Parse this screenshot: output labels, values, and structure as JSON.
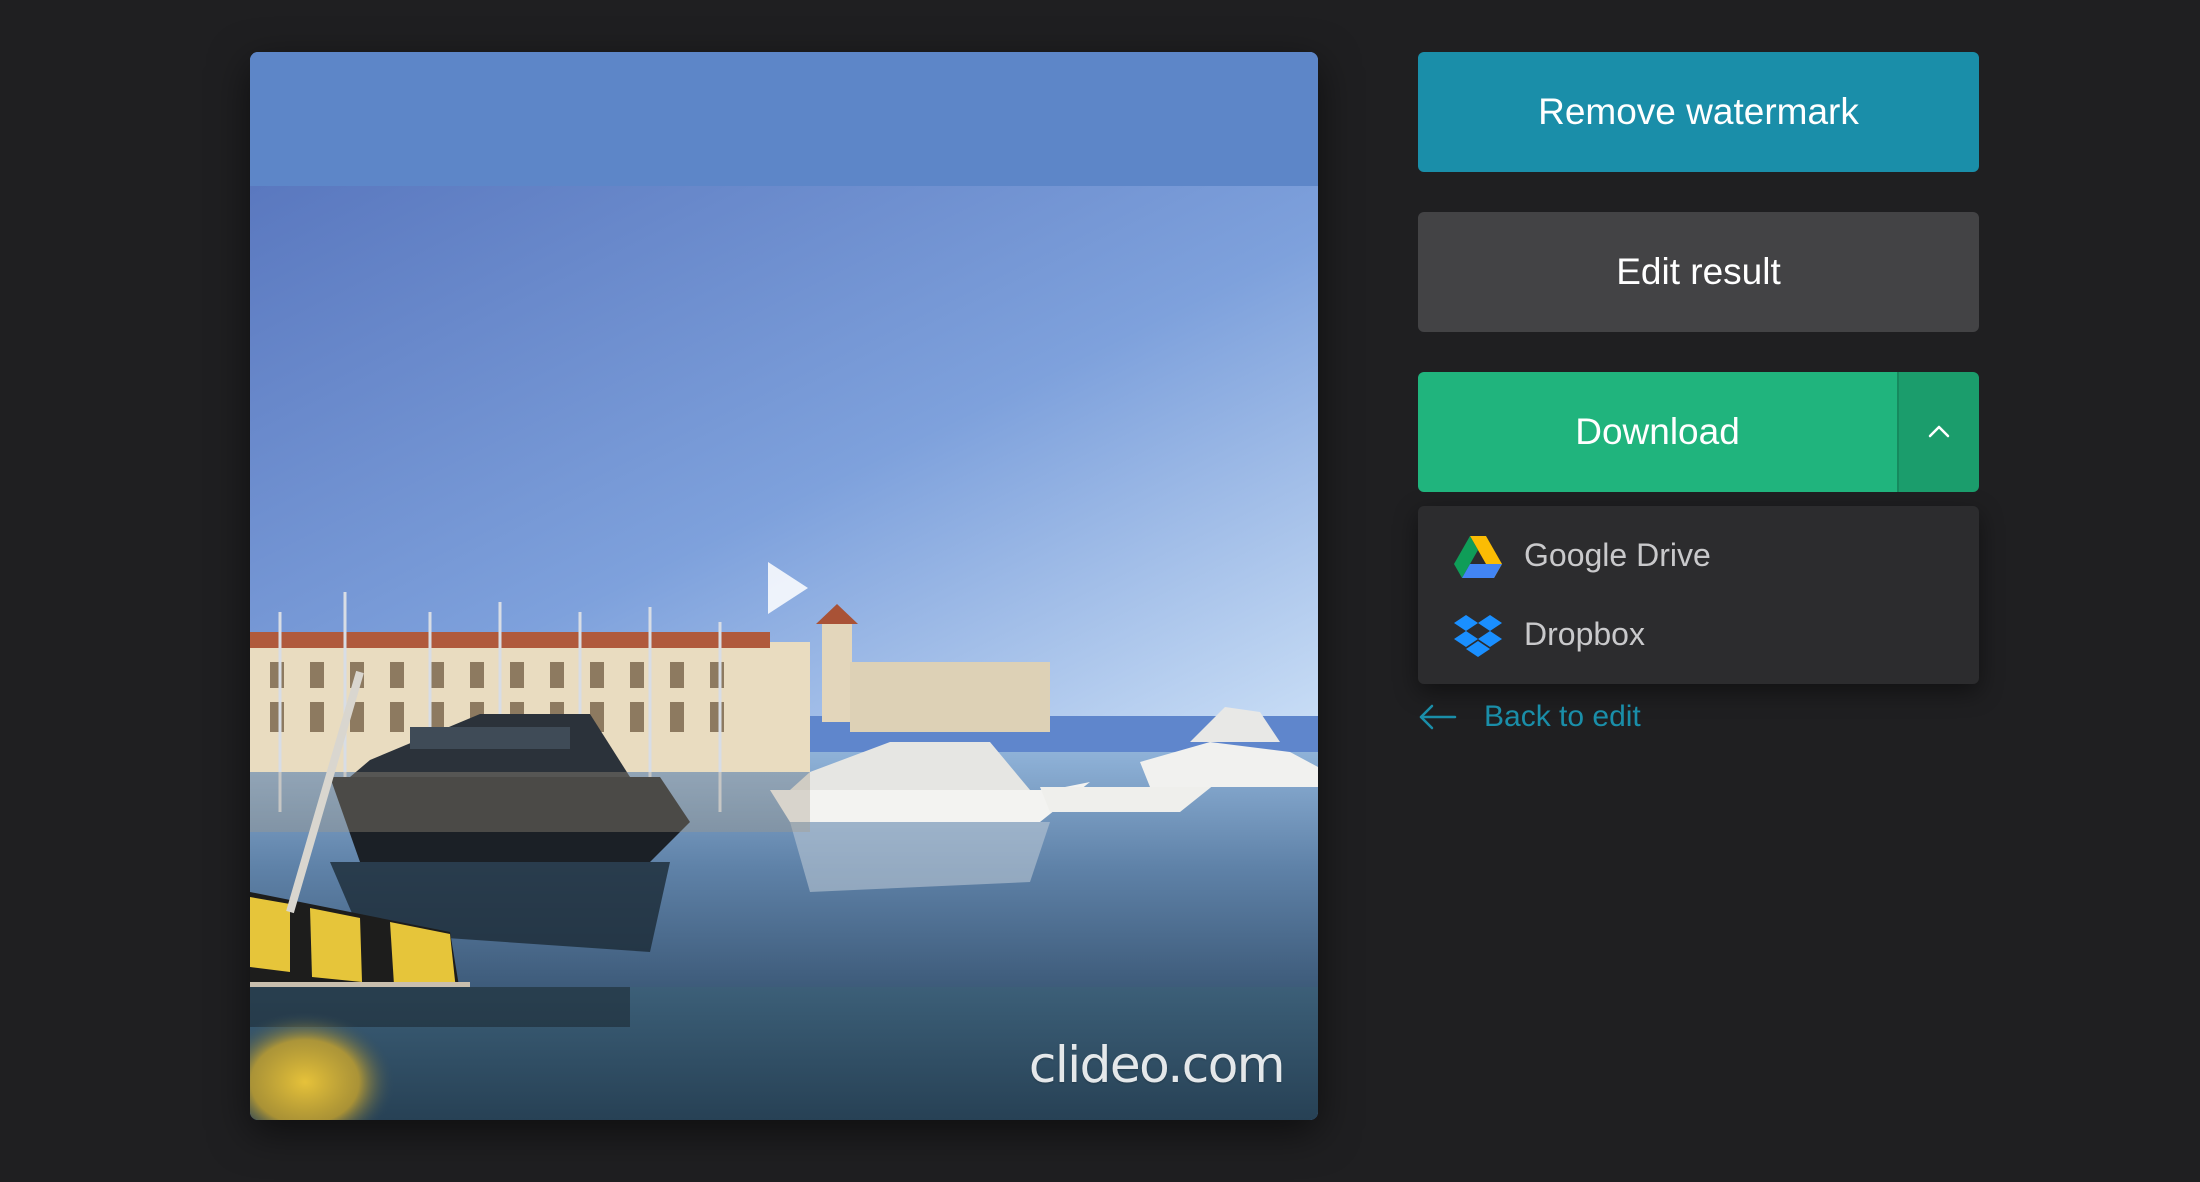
{
  "video": {
    "watermark_text": "clideo.com",
    "play_icon": "play-icon"
  },
  "actions": {
    "remove_watermark_label": "Remove watermark",
    "edit_result_label": "Edit result",
    "download_label": "Download",
    "toggle_icon": "chevron-up-icon"
  },
  "download_menu": {
    "items": [
      {
        "label": "Google Drive",
        "icon": "google-drive-icon"
      },
      {
        "label": "Dropbox",
        "icon": "dropbox-icon"
      }
    ]
  },
  "back_link": {
    "label": "Back to edit",
    "icon": "arrow-left-icon"
  },
  "colors": {
    "background": "#1f1f21",
    "watermark_button": "#1a8ea9",
    "edit_button": "#434345",
    "download_button": "#20b47d",
    "download_toggle": "#1b9d6c",
    "menu_background": "#2c2c2e",
    "link": "#1a8ea9"
  }
}
